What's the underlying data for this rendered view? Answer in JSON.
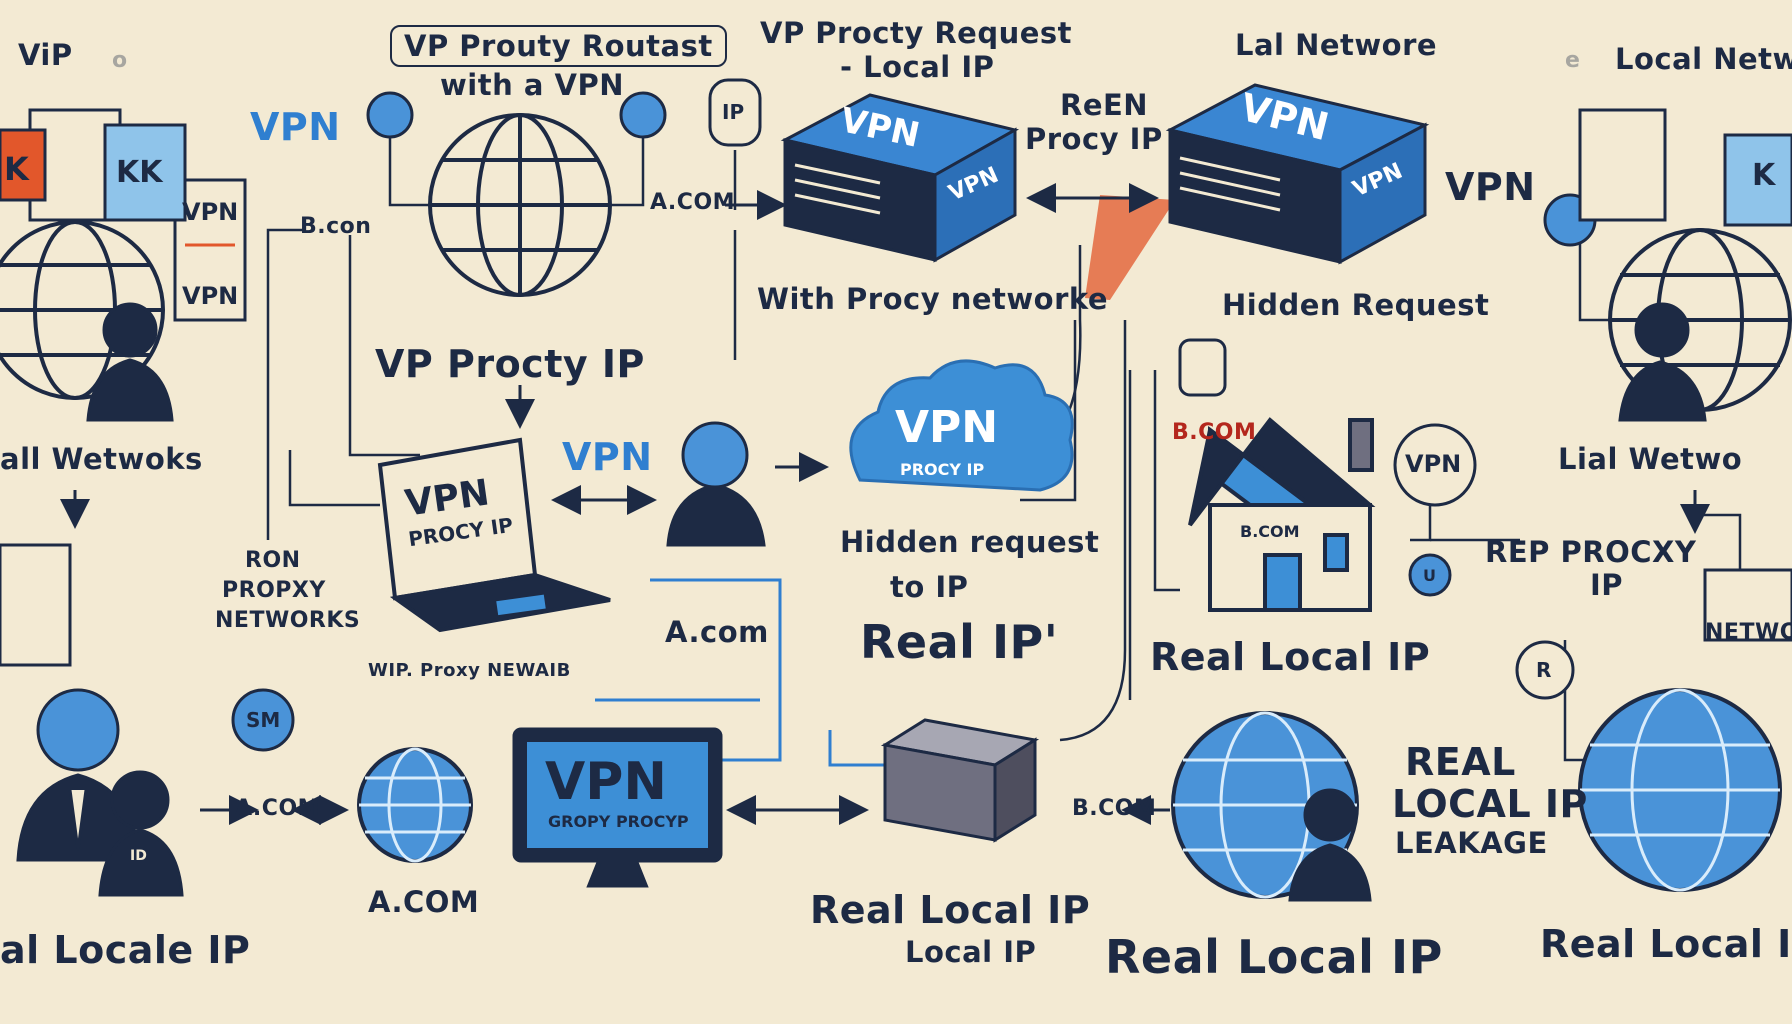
{
  "colors": {
    "background": "#f3ead3",
    "ink": "#1d2a44",
    "vpn_blue": "#2f7fd0",
    "light_blue": "#7bbbe8",
    "orange": "#e2572b",
    "red": "#b4271d"
  },
  "icons": [
    "globe-icon",
    "user-icon",
    "vpn-server-icon",
    "vpn-cloud-icon",
    "laptop-icon",
    "monitor-icon",
    "house-icon",
    "pin-icon",
    "document-icon",
    "router-box-icon",
    "arrow-icon"
  ],
  "labels": {
    "top_left_vip": "ViP",
    "top_left_faint": "o",
    "top_boxed_title": "VP Prouty Routast",
    "top_with_vpn": "with a VPN",
    "top_center_title": "VP Procty Request",
    "top_center_sub": "- Local IP",
    "top_lal_network": "Lal Networe",
    "top_right_local": "Local Netwo",
    "top_right_faint": "e",
    "vpn_left_word": "VPN",
    "vpn_right_word": "VPN",
    "pin_ip": "IP",
    "a_com_top": "A.COM",
    "reen_procy_1": "ReEN",
    "reen_procy_2": "Procy IP",
    "b_con_tag": "B.con",
    "with_procy_network": "With Procy networke",
    "hidden_request_right": "Hidden Request",
    "vp_procy_ip": "VP Procty IP",
    "all_networks": "all Wetwoks",
    "b_com_red": "B.COM",
    "lial_network": "Lial Wetwo",
    "vpn_mid_word": "VPN",
    "hidden_request_mid_1": "Hidden request",
    "hidden_request_mid_2": "to IP",
    "real_ip": "Real IP'",
    "ron_1": "RON",
    "ron_2": "PROPXY",
    "ron_3": "NETWORKS",
    "a_com_mid": "A.com",
    "real_local_ip_mid": "Real Local IP",
    "rep_procy_1": "REP PROCXY",
    "rep_procy_2": "IP",
    "netwo_box": "NETWO",
    "wip_proxy": "WIP. Proxy NEWAIB",
    "a_com_left_arrow": "A.COM",
    "b_com_right_arrow": "B.COM",
    "a_com_bottom": "A.COM",
    "real_local_leakage_1": "REAL",
    "real_local_leakage_2": "LOCAL IP",
    "real_local_leakage_3": "LEAKAGE",
    "real_locale_ip": "al Locale IP",
    "real_local_ip_bottom_1": "Real Local IP",
    "real_local_ip_bottom_2": "Local IP",
    "real_local_ip_big": "Real Local IP",
    "real_local_ip_right": "Real Local I"
  },
  "devices": {
    "server_left": "VPN",
    "server_left_side": "VPN",
    "server_right": "VPN",
    "server_right_side": "VPN",
    "cloud_main": "VPN",
    "cloud_sub": "PROCY IP",
    "laptop_main": "VPN",
    "laptop_sub": "PROCY IP",
    "monitor_main": "VPN",
    "monitor_sub": "GROPY PROCYP",
    "house_label": "B.COM",
    "vpn_pin": "VPN",
    "vpn_doc_1": "VPN",
    "vpn_doc_2": "VPN",
    "book_left_1": "K",
    "book_left_2": "KK",
    "book_right": "K",
    "pin_sm": "SM",
    "pin_r": "R",
    "person_badge": "ID",
    "router_u": "U"
  }
}
